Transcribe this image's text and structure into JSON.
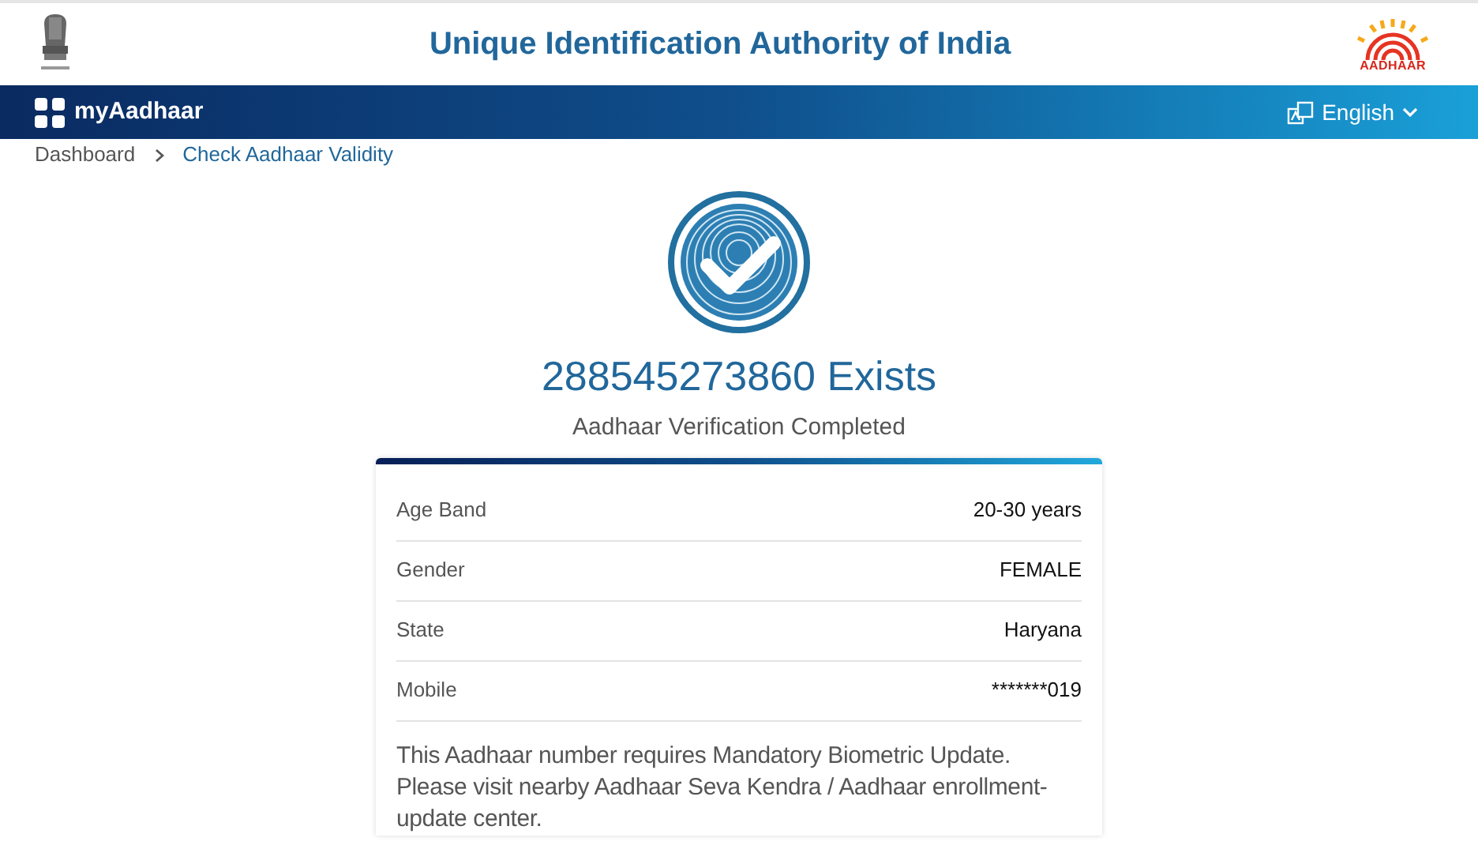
{
  "header": {
    "title": "Unique Identification Authority of India",
    "logo_text": "AADHAAR"
  },
  "navbar": {
    "brand": "myAadhaar",
    "language": "English"
  },
  "breadcrumb": [
    {
      "label": "Dashboard",
      "current": false
    },
    {
      "label": "Check Aadhaar Validity",
      "current": true
    }
  ],
  "result": {
    "heading": "288545273860 Exists",
    "subtitle": "Aadhaar Verification Completed"
  },
  "details": [
    {
      "label": "Age Band",
      "value": "20-30 years"
    },
    {
      "label": "Gender",
      "value": "FEMALE"
    },
    {
      "label": "State",
      "value": "Haryana"
    },
    {
      "label": "Mobile",
      "value": "*******019"
    }
  ],
  "notice": "This Aadhaar number requires Mandatory Biometric Update. Please visit nearby Aadhaar Seva Kendra / Aadhaar enrollment-update center."
}
